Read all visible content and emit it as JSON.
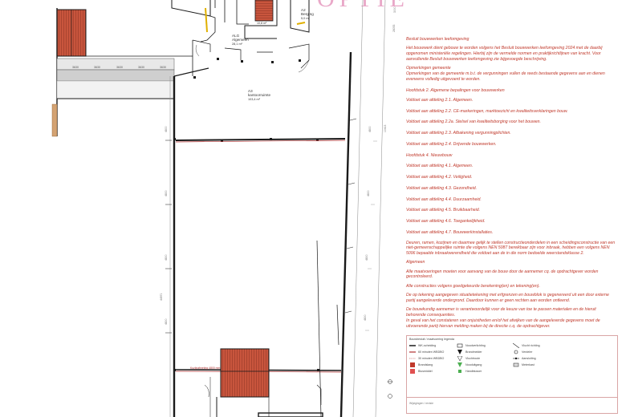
{
  "watermark": "OPTIE",
  "rooms": {
    "a2": {
      "code": "A2",
      "name": "Berging",
      "area": "5,0 m²"
    },
    "alg": {
      "code": "ALG",
      "name": "Algemeen",
      "area": "28,1 m²"
    },
    "a3": {
      "code": "A3",
      "name": "kantoorruimte",
      "area": "103,4 m²"
    },
    "small_area": "10,8 m²"
  },
  "dimensions": {
    "top_strip": [
      "3630",
      "3630",
      "3630",
      "3630",
      "3630"
    ],
    "left_vertical": [
      "4800",
      "4800",
      "4800",
      "4800",
      "44971"
    ],
    "right_vertical": [
      "4800",
      "4800",
      "4800",
      "4800",
      "4800"
    ],
    "far_right": [
      "28053",
      "10413",
      "3000"
    ],
    "bottom_label": "Kozijnafmeting 4800 mm"
  },
  "notes": {
    "title": "Besluit bouwwerken leefomgeving",
    "intro": "Het bouwwerk dient gebouw te worden volgens het Besluit bouwwerken leefomgeving 2024 met de daarbij opgenomen ministeriële regelingen. Hierbij zijn de vermelde normen en praktijkrichtlijnen van kracht. Voor aanvullende Besluit bouwwerken leefomgeving zie bijgevoegde beschrijving.",
    "opm_title": "Opmerkingen gemeente",
    "opm_text": "Opmerkingen van de gemeente m.b.t. de vergunningen vullen de reeds bestaande gegevens aan en dienen eveneens volledig uitgevoerd te worden.",
    "h2": "Hoofdstuk 2. Algemene bepalingen voor bouwwerken",
    "items2": [
      "Voldoet aan afdeling 2.1. Algemeen.",
      "Voldoet aan afdeling 2.2. CE-markeringen, marktoezicht en kwaliteitsverklaringen bouw.",
      "Voldoet aan afdeling 2.2a. Stelsel van kwaliteitsborging voor het bouwen.",
      "Voldoet aan afdeling 2.3. Afbakening vergunningplichten.",
      "Voldoet aan afdeling 2.4. Drijvende bouwwerken."
    ],
    "h4": "Hoofdstuk 4. Nieuwbouw",
    "items4": [
      "Voldoet aan afdeling 4.1. Algemeen.",
      "Voldoet aan afdeling 4.2. Veiligheid.",
      "Voldoet aan afdeling 4.3. Gezondheid.",
      "Voldoet aan afdeling 4.4. Duurzaamheid.",
      "Voldoet aan afdeling 4.5. Bruikbaarheid.",
      "Voldoet aan afdeling 4.6. Toegankelijkheid.",
      "Voldoet aan afdeling 4.7. Bouwwerkinstallaties."
    ],
    "deuren": "Deuren, ramen, kozijnen en daarmee gelijk te stellen constructieonderdelen in een scheidingsconstructie van een niet-gemeenschappelijke ruimte die volgens NEN 5087 bereikbaar zijn voor inbraak, hebben een volgens NEN 5096 bepaalde inbraakwerendheid die voldoet aan de in die norm bedoelde weerstandsklasse 2.",
    "alg_title": "Algemeen",
    "alg1": "Alle maatvoeringen moeten voor aanvang van de bouw door de aannemer cq. de opdrachtgever worden gecontroleerd.",
    "alg2": "Alle constructies volgens goedgekeurde berekening(en) en tekening(en).",
    "alg3": "De op tekening aangegeven situatietekening met erfgrenzen en bouwblok is gegenereerd uit een door externe partij aangeleverde ondergrond. Daardoor kunnen er geen rechten aan worden ontleend.",
    "alg4": "De bouwkundig aannemer is verantwoordelijk voor de keuze van toe te passen materialen en de hieruit behorende consequenties.\nIn geval van het constateren van onjuistheden en/of het afwijken van de aangeleverde gegevens moet de uitvoerende partij hiervan melding maken bij de directie c.q. de opdrachtgever."
  },
  "legend": {
    "title": "Bouwbesluit / maatvoering legenda",
    "items": [
      "WK-scheiding",
      "60 minuten WBDBO",
      "30 minuten WBDBO",
      "Brandslang",
      "Blusmiddel",
      "Noodverlichting",
      "Brandmelder",
      "Vluchtroute",
      "Nooduitgang",
      "Handblusser",
      "Vlucht richting",
      "Verdeler",
      "Aansluiting",
      "Meterkast"
    ],
    "footer": "Wijzigingen / revisie"
  },
  "colors": {
    "wall": "#1a1a1a",
    "fire_line": "#b03030",
    "stair": "#c8553d",
    "grid": "#555555",
    "note_text": "#c0392b",
    "watermark": "#e9a8c8"
  }
}
